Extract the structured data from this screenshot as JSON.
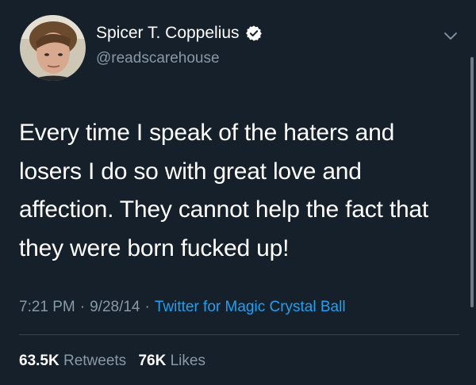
{
  "author": {
    "display_name": "Spicer T. Coppelius",
    "handle": "@readscarehouse",
    "verified_icon": "verified-badge-icon",
    "avatar_icon": "avatar-photo"
  },
  "tweet": {
    "text": "Every time I speak of the haters and losers I do so with great love and affection. They cannot help the fact that they were born fucked up!",
    "time": "7:21 PM",
    "date": "9/28/14",
    "separator": "·",
    "source": "Twitter for Magic Crystal Ball"
  },
  "stats": {
    "retweets_count": "63.5K",
    "retweets_label": "Retweets",
    "likes_count": "76K",
    "likes_label": "Likes"
  },
  "colors": {
    "background": "#15202b",
    "text": "#ffffff",
    "muted": "#8899a6",
    "accent": "#1da1f2",
    "divider": "#38444d"
  },
  "icons": {
    "menu": "chevron-down-icon"
  }
}
